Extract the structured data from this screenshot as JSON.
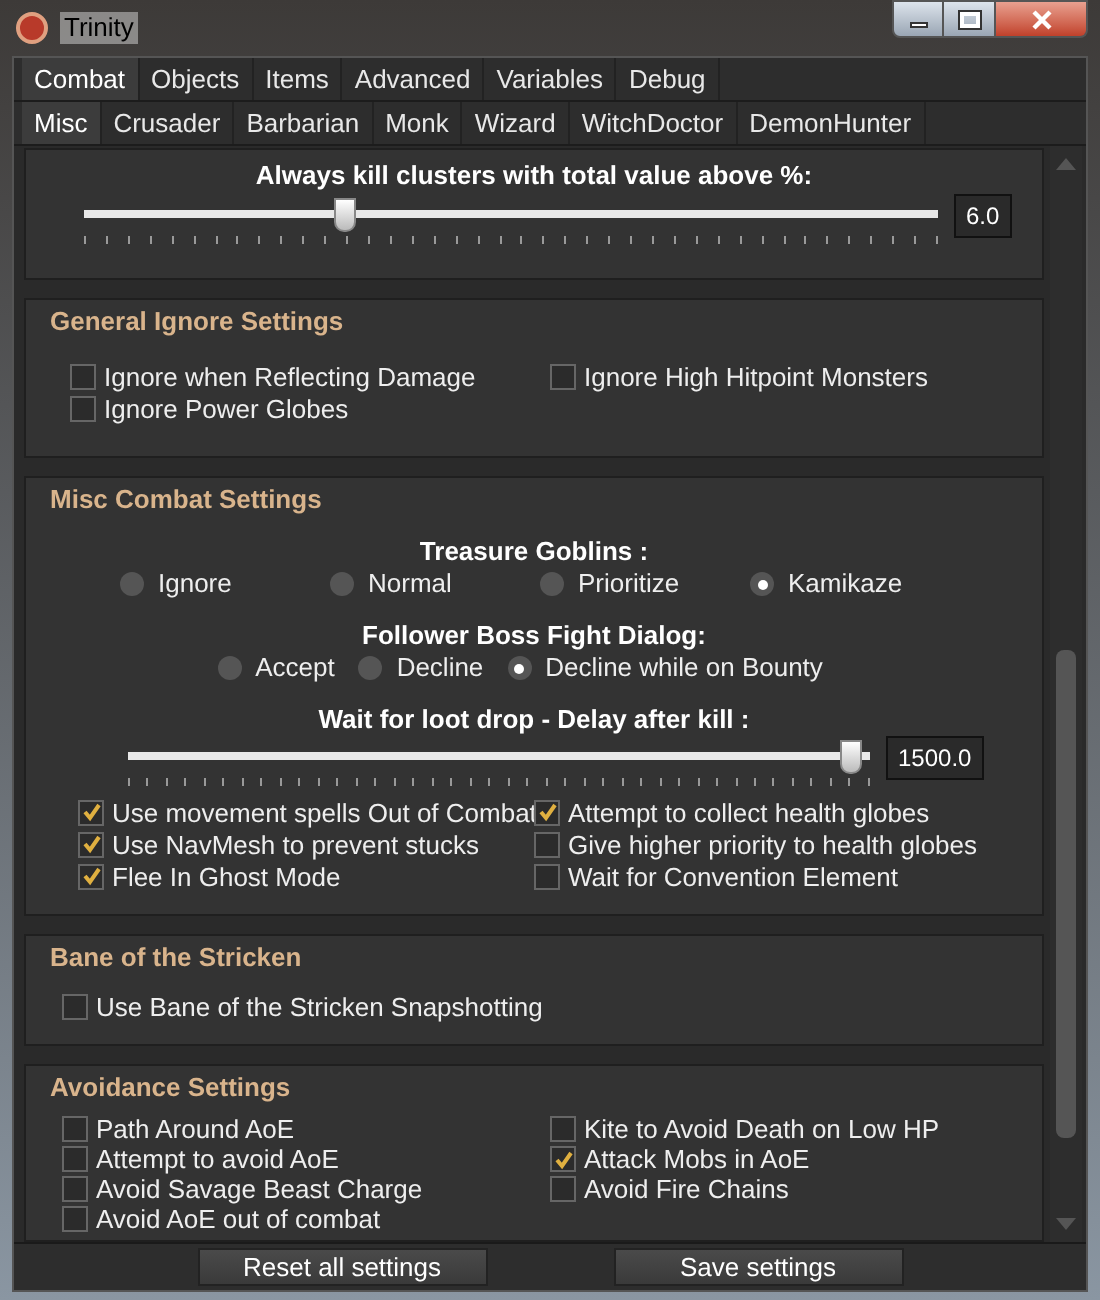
{
  "window": {
    "title": "Trinity"
  },
  "tabs_top": [
    {
      "label": "Combat",
      "selected": true
    },
    {
      "label": "Objects",
      "selected": false
    },
    {
      "label": "Items",
      "selected": false
    },
    {
      "label": "Advanced",
      "selected": false
    },
    {
      "label": "Variables",
      "selected": false
    },
    {
      "label": "Debug",
      "selected": false
    }
  ],
  "tabs_sub": [
    {
      "label": "Misc",
      "selected": true
    },
    {
      "label": "Crusader",
      "selected": false
    },
    {
      "label": "Barbarian",
      "selected": false
    },
    {
      "label": "Monk",
      "selected": false
    },
    {
      "label": "Wizard",
      "selected": false
    },
    {
      "label": "WitchDoctor",
      "selected": false
    },
    {
      "label": "DemonHunter",
      "selected": false
    }
  ],
  "cluster_slider": {
    "label": "Always kill clusters with total value above %:",
    "level": 0.3,
    "value": "6.0"
  },
  "general_ignore": {
    "title": "General Ignore Settings",
    "options": [
      {
        "label": "Ignore when Reflecting Damage",
        "checked": false
      },
      {
        "label": "Ignore High Hitpoint Monsters",
        "checked": false
      },
      {
        "label": "Ignore Power Globes",
        "checked": false
      }
    ]
  },
  "misc_combat": {
    "title": "Misc Combat Settings",
    "treasure_goblins": {
      "label": "Treasure Goblins :",
      "options": [
        {
          "label": "Ignore",
          "selected": false
        },
        {
          "label": "Normal",
          "selected": false
        },
        {
          "label": "Prioritize",
          "selected": false
        },
        {
          "label": "Kamikaze",
          "selected": true
        }
      ]
    },
    "follower_dialog": {
      "label": "Follower Boss Fight Dialog:",
      "options": [
        {
          "label": "Accept",
          "selected": false
        },
        {
          "label": "Decline",
          "selected": false
        },
        {
          "label": "Decline while on Bounty",
          "selected": true
        }
      ]
    },
    "loot_slider": {
      "label": "Wait for loot drop - Delay after kill :",
      "level": 0.99,
      "value": "1500.0"
    },
    "options": [
      {
        "label": "Use movement spells Out of Combat",
        "checked": true
      },
      {
        "label": "Attempt to collect health globes",
        "checked": true
      },
      {
        "label": "Use NavMesh to prevent stucks",
        "checked": true
      },
      {
        "label": "Give higher priority to health globes",
        "checked": false
      },
      {
        "label": "Flee In Ghost Mode",
        "checked": true
      },
      {
        "label": "Wait for Convention Element",
        "checked": false
      }
    ]
  },
  "bane": {
    "title": "Bane of the Stricken",
    "options": [
      {
        "label": "Use Bane of the Stricken Snapshotting",
        "checked": false
      }
    ]
  },
  "avoidance": {
    "title": "Avoidance Settings",
    "options": [
      {
        "label": "Path Around AoE",
        "checked": false
      },
      {
        "label": "Kite to Avoid Death on Low HP",
        "checked": false
      },
      {
        "label": "Attempt to avoid AoE",
        "checked": false
      },
      {
        "label": "Attack Mobs in AoE",
        "checked": true
      },
      {
        "label": "Avoid Savage Beast Charge",
        "checked": false
      },
      {
        "label": "Avoid Fire Chains",
        "checked": false
      },
      {
        "label": "Avoid AoE out of combat",
        "checked": false
      }
    ]
  },
  "buttons": [
    "Reset all settings",
    "Save settings"
  ]
}
